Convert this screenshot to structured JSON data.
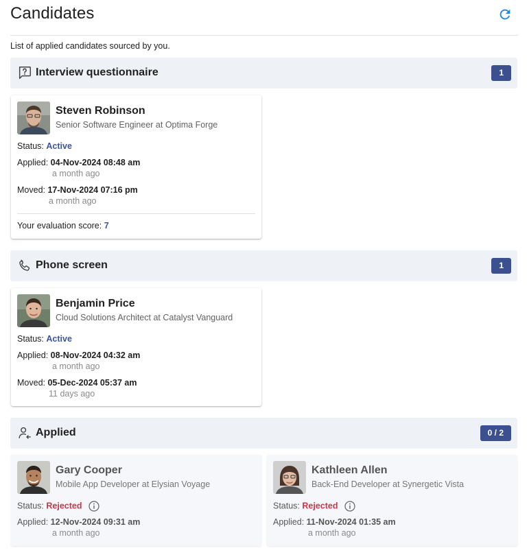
{
  "page": {
    "title": "Candidates",
    "subtitle": "List of applied candidates sourced by you."
  },
  "icons": {
    "refresh": "refresh-icon",
    "questionnaire": "chat-question-icon",
    "phone": "phone-icon",
    "applied": "person-arrow-icon",
    "info": "info-icon"
  },
  "colors": {
    "accent": "#3c4f8f",
    "active": "#3b54a0",
    "rejected": "#c8374b",
    "refresh": "#1e88e5"
  },
  "sections": [
    {
      "name": "Interview questionnaire",
      "count": "1",
      "candidates": [
        {
          "name": "Steven Robinson",
          "role": "Senior Software Engineer at Optima Forge",
          "status_label": "Status:",
          "status": "Active",
          "applied_label": "Applied:",
          "applied": "04-Nov-2024 08:48 am",
          "applied_ago": "a month ago",
          "moved_label": "Moved:",
          "moved": "17-Nov-2024 07:16 pm",
          "moved_ago": "a month ago",
          "score_label": "Your evaluation score:",
          "score": "7"
        }
      ]
    },
    {
      "name": "Phone screen",
      "count": "1",
      "candidates": [
        {
          "name": "Benjamin Price",
          "role": "Cloud Solutions Architect at Catalyst Vanguard",
          "status_label": "Status:",
          "status": "Active",
          "applied_label": "Applied:",
          "applied": "08-Nov-2024 04:32 am",
          "applied_ago": "a month ago",
          "moved_label": "Moved:",
          "moved": "05-Dec-2024 05:37 am",
          "moved_ago": "11 days ago"
        }
      ]
    },
    {
      "name": "Applied",
      "count": "0 / 2",
      "candidates": [
        {
          "name": "Gary Cooper",
          "role": "Mobile App Developer at Elysian Voyage",
          "status_label": "Status:",
          "status": "Rejected",
          "applied_label": "Applied:",
          "applied": "12-Nov-2024 09:31 am",
          "applied_ago": "a month ago"
        },
        {
          "name": "Kathleen Allen",
          "role": "Back-End Developer at Synergetic Vista",
          "status_label": "Status:",
          "status": "Rejected",
          "applied_label": "Applied:",
          "applied": "11-Nov-2024 01:35 am",
          "applied_ago": "a month ago"
        }
      ]
    }
  ]
}
